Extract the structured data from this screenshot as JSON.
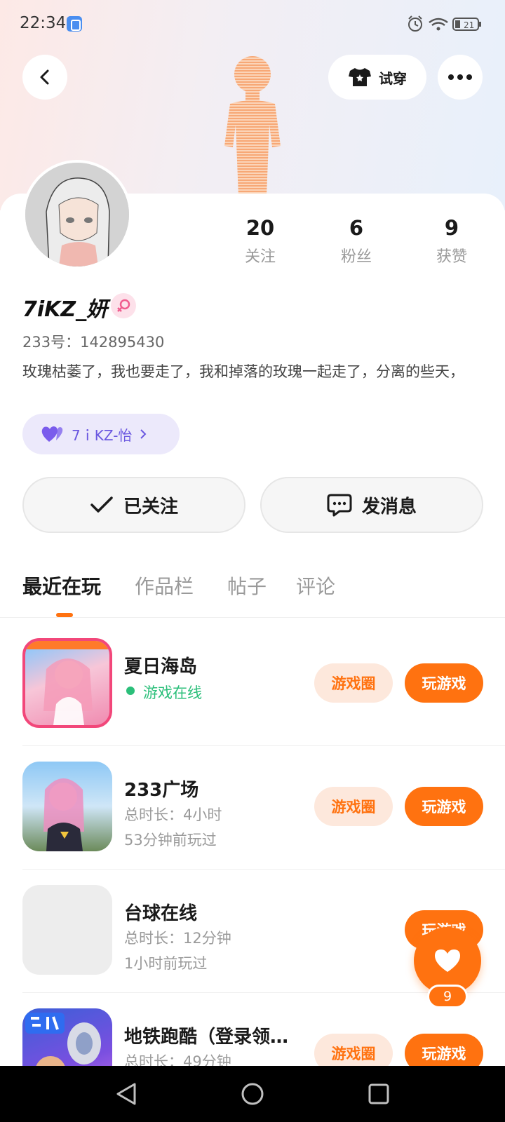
{
  "status_bar": {
    "time": "22:34",
    "battery": "21"
  },
  "header": {
    "tryon_label": "试穿"
  },
  "stats": [
    {
      "value": "20",
      "label": "关注"
    },
    {
      "value": "6",
      "label": "粉丝"
    },
    {
      "value": "9",
      "label": "获赞"
    }
  ],
  "profile": {
    "username": "7iKZ_妍",
    "uid": "233号：142895430",
    "bio": "玫瑰枯萎了，我也要走了，我和掉落的玫瑰一起走了，分离的些天，",
    "cp_tag": "7ｉKZ-怡"
  },
  "actions": {
    "follow_label": "已关注",
    "message_label": "发消息"
  },
  "tabs": [
    "最近在玩",
    "作品栏",
    "帖子",
    "评论"
  ],
  "games": [
    {
      "name": "夏日海岛",
      "line1": "游戏在线",
      "line2": "",
      "circle_label": "游戏圈",
      "play_label": "玩游戏"
    },
    {
      "name": "233广场",
      "line1": "总时长：4小时",
      "line2": "53分钟前玩过",
      "circle_label": "游戏圈",
      "play_label": "玩游戏"
    },
    {
      "name": "台球在线",
      "line1": "总时长：12分钟",
      "line2": "1小时前玩过",
      "circle_label": "",
      "play_label": "玩游戏"
    },
    {
      "name": "地铁跑酷（登录领…",
      "line1": "总时长：49分钟",
      "line2": "",
      "circle_label": "游戏圈",
      "play_label": "玩游戏"
    }
  ],
  "like_fab": {
    "count": "9"
  },
  "colors": {
    "accent": "#ff7210",
    "online": "#2bbf7a",
    "cp_purple": "#6a57e0"
  },
  "icons": [
    "back-icon",
    "shirt-icon",
    "more-icon",
    "female-icon",
    "heart-icon",
    "check-icon",
    "chat-icon",
    "alarm-icon",
    "wifi-icon",
    "battery-icon"
  ]
}
